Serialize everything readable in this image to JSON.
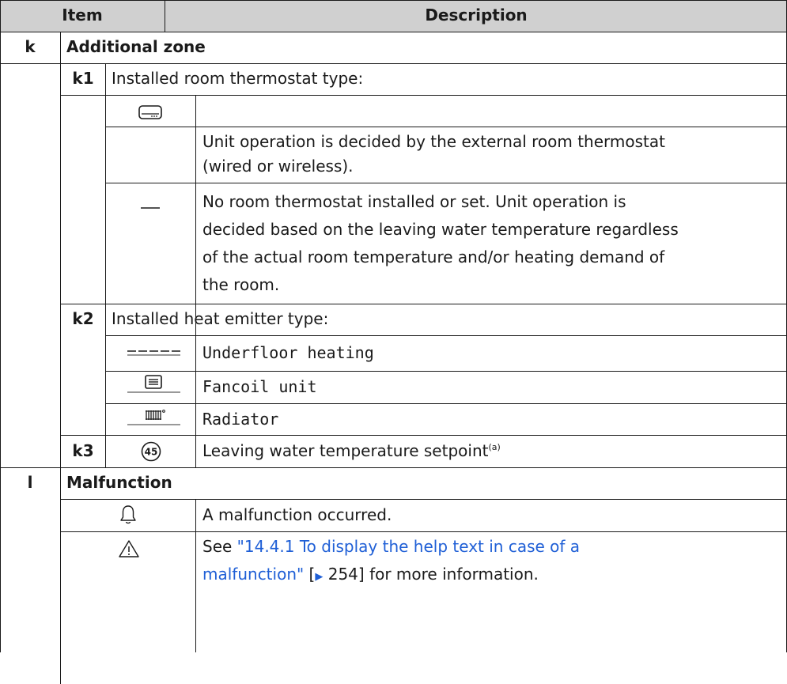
{
  "header": {
    "item": "Item",
    "description": "Description"
  },
  "k": {
    "code": "k",
    "title": "Additional zone",
    "k1": {
      "code": "k1",
      "label": "Installed room thermostat type:",
      "options": [
        {
          "icon": "room-thermostat-icon",
          "lines": [
            "Unit operation is decided by the external room thermostat",
            "(wired or wireless)."
          ]
        },
        {
          "icon": "dash-icon",
          "lines": [
            "No room thermostat installed or set. Unit operation is",
            "decided based on the leaving water temperature regardless",
            "of the actual room temperature and/or heating demand of",
            "the room."
          ]
        }
      ]
    },
    "k2": {
      "code": "k2",
      "label": "Installed heat emitter type:",
      "options": [
        {
          "icon": "underfloor-heating-icon",
          "text": "Underfloor heating"
        },
        {
          "icon": "fancoil-unit-icon",
          "text": "Fancoil unit"
        },
        {
          "icon": "radiator-icon",
          "text": "Radiator"
        }
      ]
    },
    "k3": {
      "code": "k3",
      "icon_value": "45",
      "text": "Leaving water temperature setpoint",
      "footnote": "(a)"
    }
  },
  "l": {
    "code": "l",
    "title": "Malfunction",
    "bell_text": "A malfunction occurred.",
    "warning_text": {
      "prefix": "See ",
      "link_line1": "\"14.4.1 To display the help text in case of a",
      "link_line2": "malfunction\"",
      "page_ref_open": " [",
      "page_ref_arrow": "▶",
      "page_ref_num": " 254]",
      "suffix": " for more information."
    }
  },
  "colors": {
    "header_bg": "#d0d0d0",
    "text": "#1a1a1a",
    "link": "#1f5fd6"
  }
}
